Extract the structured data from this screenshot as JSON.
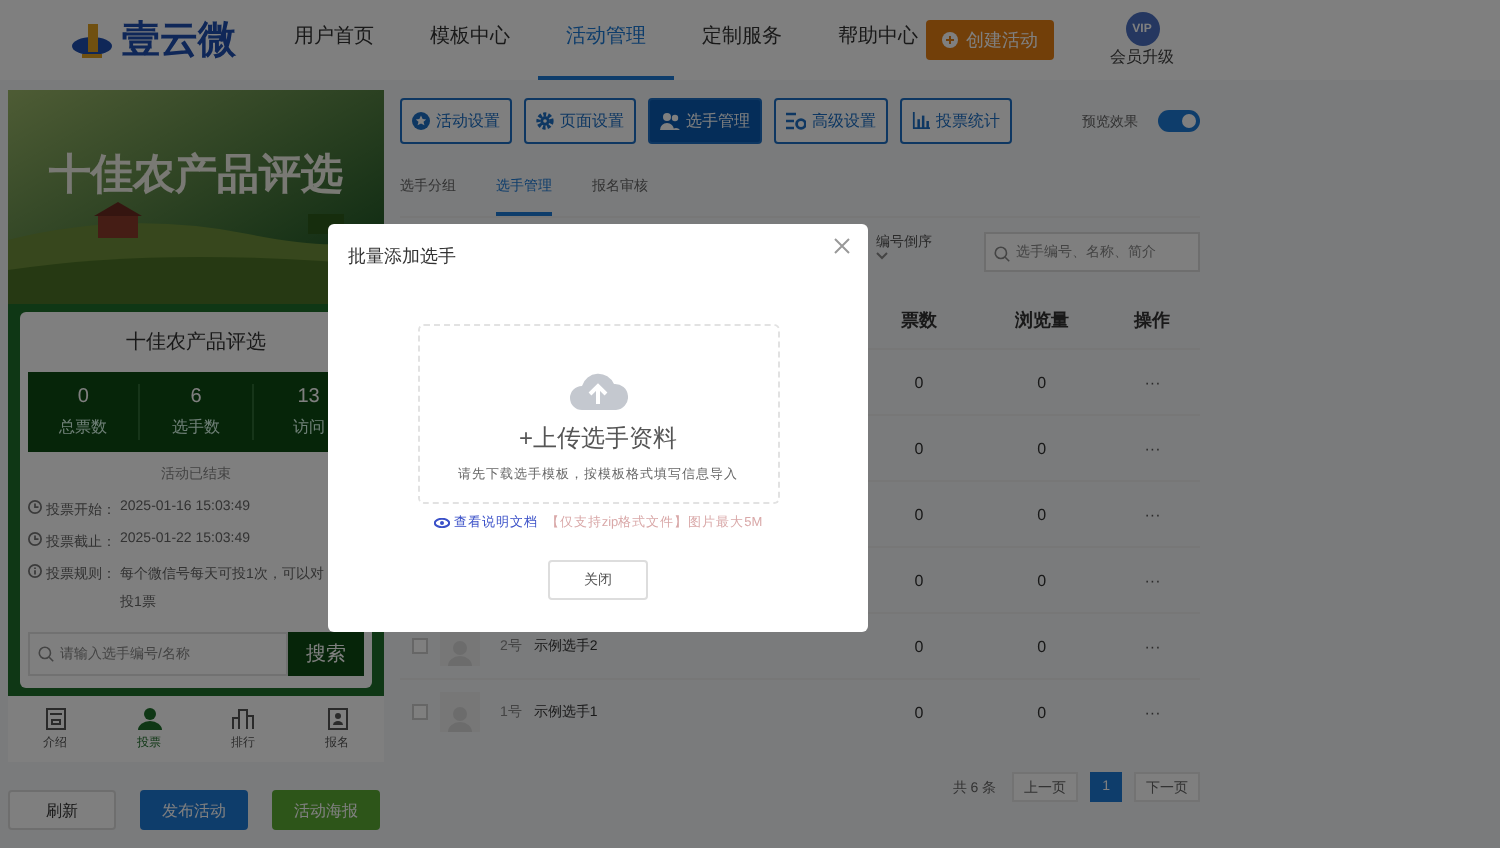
{
  "header": {
    "logo_text": "壹云微",
    "nav": [
      {
        "label": "用户首页",
        "selected": false
      },
      {
        "label": "模板中心",
        "selected": false
      },
      {
        "label": "活动管理",
        "selected": true
      },
      {
        "label": "定制服务",
        "selected": false
      },
      {
        "label": "帮助中心",
        "selected": false
      }
    ],
    "create_button": "创建活动",
    "vip": {
      "badge": "VIP",
      "label": "会员升级"
    }
  },
  "preview": {
    "banner_title": "十佳农产品评选",
    "card_title": "十佳农产品评选",
    "stats": [
      {
        "value": "0",
        "label": "总票数"
      },
      {
        "value": "6",
        "label": "选手数"
      },
      {
        "value": "13",
        "label": "访问"
      }
    ],
    "status": "活动已结束",
    "info": [
      {
        "kind": "clock",
        "label": "投票开始：",
        "value": "2025-01-16 15:03:49"
      },
      {
        "kind": "clock",
        "label": "投票截止：",
        "value": "2025-01-22 15:03:49"
      },
      {
        "kind": "info",
        "label": "投票规则：",
        "value": "每个微信号每天可投1次，可以对",
        "value_continued": "投1票"
      }
    ],
    "search_placeholder": "请输入选手编号/名称",
    "search_button": "搜索",
    "bottom_nav": [
      {
        "kind": "intro",
        "label": "介绍",
        "selected": false
      },
      {
        "kind": "vote",
        "label": "投票",
        "selected": true
      },
      {
        "kind": "rank",
        "label": "排行",
        "selected": false
      },
      {
        "kind": "signup",
        "label": "报名",
        "selected": false
      }
    ]
  },
  "actions": [
    {
      "kind": "plain",
      "label": "刷新"
    },
    {
      "kind": "primary",
      "label": "发布活动"
    },
    {
      "kind": "success",
      "label": "活动海报"
    }
  ],
  "toolbar": [
    {
      "kind": "star",
      "label": "活动设置",
      "selected": false
    },
    {
      "kind": "gear",
      "label": "页面设置",
      "selected": false
    },
    {
      "kind": "people",
      "label": "选手管理",
      "selected": true
    },
    {
      "kind": "sliders",
      "label": "高级设置",
      "selected": false
    },
    {
      "kind": "chart",
      "label": "投票统计",
      "selected": false
    }
  ],
  "preview_toggle": {
    "label": "预览效果",
    "on": true
  },
  "subtabs": [
    {
      "label": "选手分组",
      "selected": false
    },
    {
      "label": "选手管理",
      "selected": true
    },
    {
      "label": "报名审核",
      "selected": false
    }
  ],
  "filter": {
    "sort": "编号倒序",
    "search_placeholder": "选手编号、名称、简介"
  },
  "table": {
    "columns": [
      "票数",
      "浏览量",
      "操作"
    ],
    "rows": [
      {
        "votes": "0",
        "views": "0",
        "ops": "···"
      },
      {
        "votes": "0",
        "views": "0",
        "ops": "···"
      },
      {
        "votes": "0",
        "views": "0",
        "ops": "···"
      },
      {
        "votes": "0",
        "views": "0",
        "ops": "···"
      },
      {
        "checked": false,
        "number": "2号",
        "name": "示例选手2",
        "votes": "0",
        "views": "0",
        "ops": "···"
      },
      {
        "checked": false,
        "number": "1号",
        "name": "示例选手1",
        "votes": "0",
        "views": "0",
        "ops": "···"
      }
    ]
  },
  "pagination": {
    "total": "共 6 条",
    "prev": "上一页",
    "pages": [
      {
        "label": "1",
        "selected": true
      }
    ],
    "next": "下一页"
  },
  "modal": {
    "title": "批量添加选手",
    "upload_title": "+上传选手资料",
    "upload_hint": "请先下载选手模板，按模板格式填写信息导入",
    "doc_link": "查看说明文档",
    "note": "【仅支持zip格式文件】图片最大5M",
    "close_button": "关闭"
  }
}
